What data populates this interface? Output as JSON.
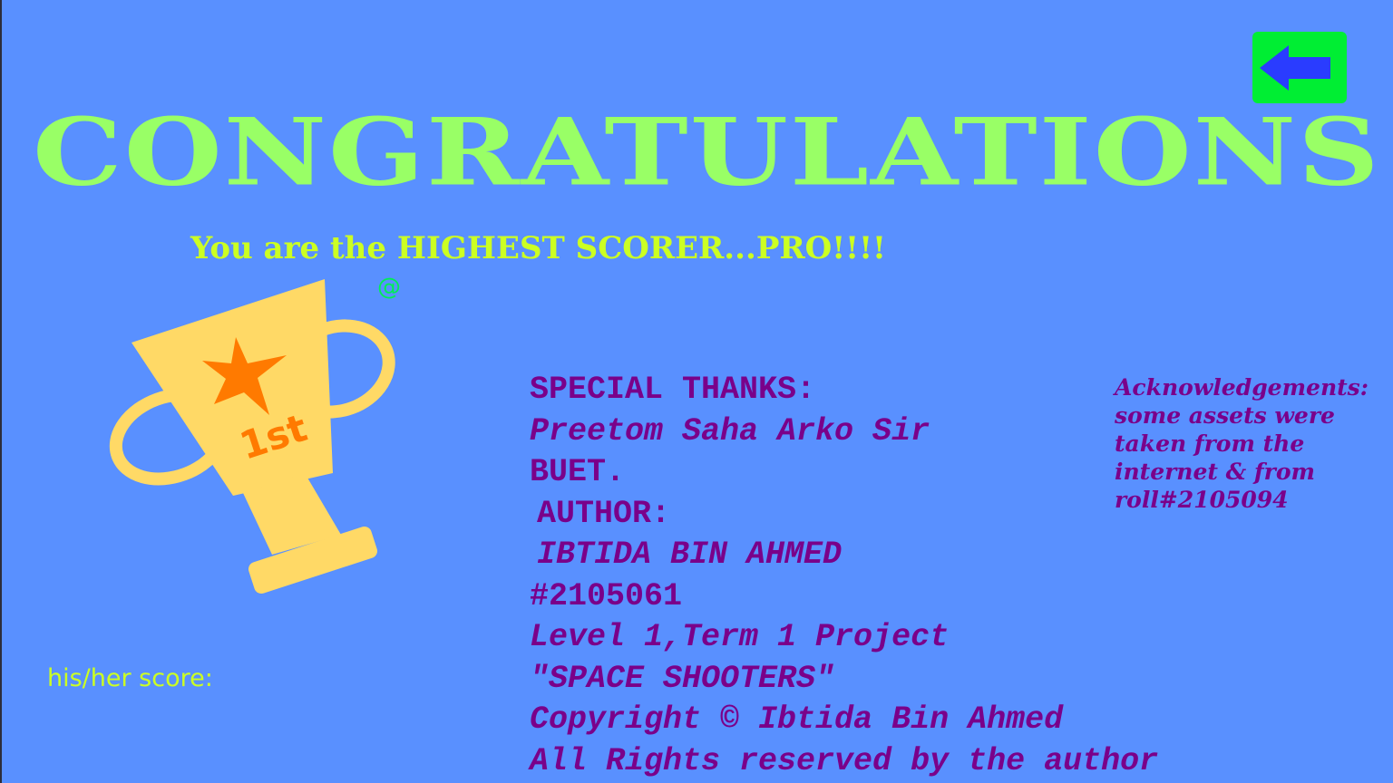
{
  "screen": {
    "title": "CONGRATULATIONS",
    "subtitle": "You are the HIGHEST SCORER...PRO!!!!",
    "at_symbol": "@",
    "score_label": "his/her score:",
    "trophy_text": "1st"
  },
  "back_button": {
    "icon": "left-arrow-icon"
  },
  "credits": {
    "special_thanks_heading": "SPECIAL THANKS:",
    "thanks_name": "Preetom Saha Arko Sir",
    "institution": "BUET.",
    "author_heading": "AUTHOR:",
    "author_name": "IBTIDA BIN AHMED",
    "roll": "#2105061",
    "project": "Level 1,Term 1 Project",
    "game_name": "\"SPACE SHOOTERS\"",
    "copyright": "Copyright © Ibtida Bin Ahmed",
    "rights": "All Rights reserved by the author"
  },
  "acknowledgements": {
    "line1": "Acknowledgements:",
    "line2": "some assets were",
    "line3": "taken from the",
    "line4": "internet & from",
    "line5": "roll#2105094"
  },
  "colors": {
    "background": "#5990ff",
    "title": "#99ff66",
    "subtitle": "#ccff22",
    "credits_text": "#7a008a",
    "back_button": "#00ee33",
    "arrow": "#2a3cff",
    "trophy": "#ffd966",
    "star": "#ff7a00"
  }
}
